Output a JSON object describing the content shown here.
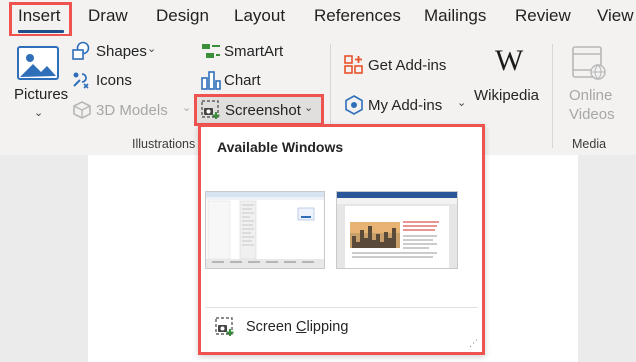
{
  "tabs": [
    "Insert",
    "Draw",
    "Design",
    "Layout",
    "References",
    "Mailings",
    "Review",
    "View"
  ],
  "ribbon": {
    "pictures": "Pictures",
    "shapes": "Shapes",
    "icons": "Icons",
    "models_3d": "3D Models",
    "smartart": "SmartArt",
    "chart": "Chart",
    "screenshot": "Screenshot",
    "get_addins": "Get Add-ins",
    "my_addins": "My Add-ins",
    "wikipedia": "Wikipedia",
    "online_videos_line1": "Online",
    "online_videos_line2": "Videos",
    "illustrations_label": "Illustrations",
    "media_label": "Media"
  },
  "screenshot_menu": {
    "title": "Available Windows",
    "screen_clipping_prefix": "Screen ",
    "screen_clipping_accesskey": "C",
    "screen_clipping_suffix": "lipping"
  },
  "colors": {
    "highlight_red": "#ef5350",
    "tab_underline": "#1e4e8c",
    "icon_blue": "#2f6fba",
    "icon_green": "#3a8f3a",
    "addins_orange": "#e8532b"
  }
}
